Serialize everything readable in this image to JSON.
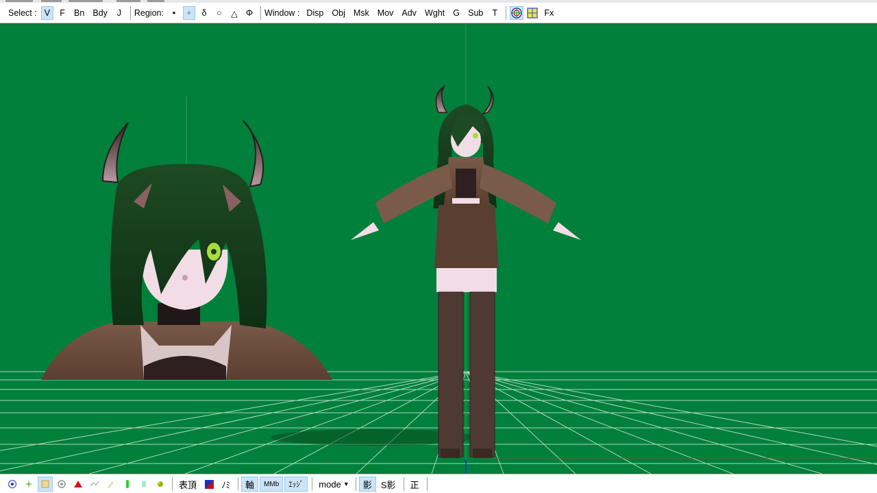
{
  "toolbar": {
    "select_label": "Select :",
    "select_items": [
      "V",
      "F",
      "Bn",
      "Bdy",
      "J"
    ],
    "region_label": "Region:",
    "region_items": [
      "•",
      "▫",
      "δ",
      "○",
      "△",
      "Φ"
    ],
    "window_label": "Window :",
    "window_items": [
      "Disp",
      "Obj",
      "Msk",
      "Mov",
      "Adv",
      "Wght",
      "G",
      "Sub",
      "T"
    ],
    "fx_label": "Fx"
  },
  "bottom": {
    "hyochou_label": "表頂",
    "nomi_label": "ﾉﾐ",
    "axis_label": "軸",
    "mb_label": "MMb",
    "edge_label": "ｴｯｼﾞ",
    "mode_label": "mode",
    "mode_arrow": "▾",
    "shadow_label": "影",
    "sshadow_label": "S影",
    "front_label": "正"
  },
  "colors": {
    "viewport_bg": "#00803a",
    "grid_line": "#cfe8d4",
    "toggle_on": "#cce4f7"
  },
  "icons": [
    "circle-target-icon",
    "grid-toggle-icon",
    "vertex-icon",
    "sparkle-icon",
    "face-select-icon",
    "triangle-icon",
    "line-icon",
    "brush-icon",
    "green-bottle-icon",
    "cylinder-icon",
    "yellow-shape-icon",
    "color-swatch-icon"
  ]
}
